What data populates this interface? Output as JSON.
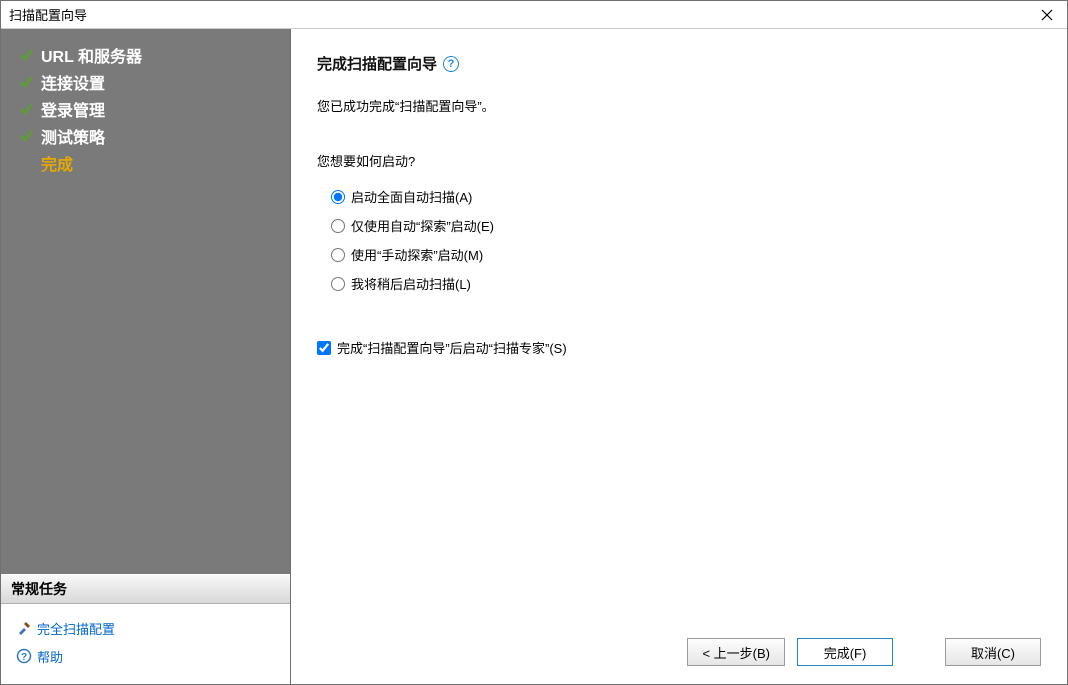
{
  "window": {
    "title": "扫描配置向导"
  },
  "sidebar": {
    "steps": [
      {
        "label": "URL 和服务器",
        "done": true,
        "active": false
      },
      {
        "label": "连接设置",
        "done": true,
        "active": false
      },
      {
        "label": "登录管理",
        "done": true,
        "active": false
      },
      {
        "label": "测试策略",
        "done": true,
        "active": false
      },
      {
        "label": "完成",
        "done": false,
        "active": true
      }
    ],
    "tasks_header": "常规任务",
    "tasks": [
      {
        "label": "完全扫描配置",
        "icon": "tools"
      },
      {
        "label": "帮助",
        "icon": "help"
      }
    ]
  },
  "main": {
    "heading": "完成扫描配置向导",
    "success_text": "您已成功完成“扫描配置向导”。",
    "question": "您想要如何启动?",
    "options": [
      {
        "label": "启动全面自动扫描(A)",
        "checked": true
      },
      {
        "label": "仅使用自动“探索”启动(E)",
        "checked": false
      },
      {
        "label": "使用“手动探索”启动(M)",
        "checked": false
      },
      {
        "label": "我将稍后启动扫描(L)",
        "checked": false
      }
    ],
    "checkbox": {
      "label": "完成“扫描配置向导”后启动“扫描专家”(S)",
      "checked": true
    }
  },
  "footer": {
    "back": "< 上一步(B)",
    "finish": "完成(F)",
    "cancel": "取消(C)"
  }
}
